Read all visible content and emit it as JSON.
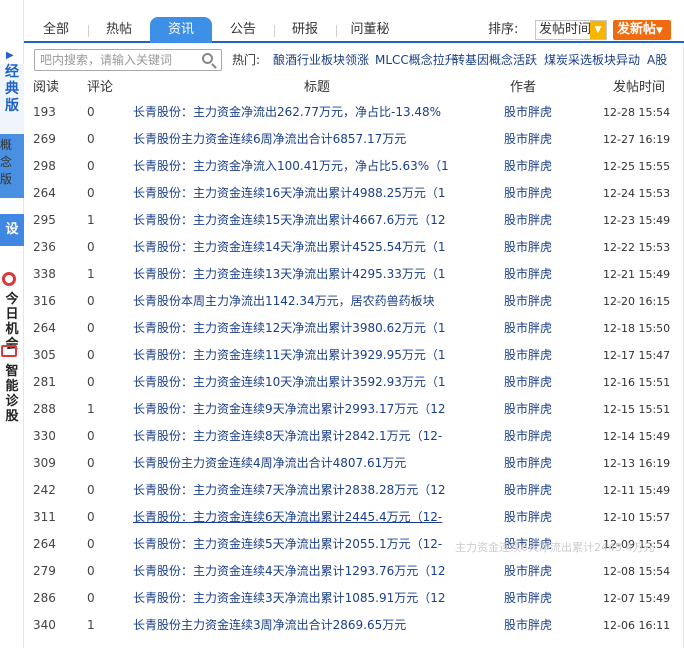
{
  "left_sidebar": {
    "classic_label": [
      "经",
      "典",
      "版"
    ],
    "concept_label": [
      "概",
      "念",
      "版"
    ],
    "settings_label": "设置",
    "meeting_label": [
      "今日",
      "机会"
    ],
    "diagnosis_label": [
      "智能",
      "诊股"
    ]
  },
  "tabs": [
    {
      "label": "全部",
      "active": false
    },
    {
      "label": "热帖",
      "active": false
    },
    {
      "label": "资讯",
      "active": true
    },
    {
      "label": "公告",
      "active": false
    },
    {
      "label": "研报",
      "active": false
    },
    {
      "label": "问董秘",
      "active": false
    }
  ],
  "sort": {
    "label": "排序:",
    "selected": "发帖时间"
  },
  "new_post_button": "发新帖",
  "search": {
    "placeholder": "吧内搜索，请输入关键词"
  },
  "hot": {
    "label": "热门:",
    "links": [
      "酿酒行业板块领涨",
      "MLCC概念拉升",
      "转基因概念活跃",
      "煤炭采选板块异动",
      "A股"
    ]
  },
  "table_header": {
    "read": "阅读",
    "comment": "评论",
    "title": "标题",
    "author": "作者",
    "time": "发帖时间"
  },
  "rows": [
    {
      "read": "193",
      "comment": "0",
      "title": "长青股份：主力资金净流出262.77万元，净占比-13.48%",
      "author": "股市胖虎",
      "time": "12-28 15:54"
    },
    {
      "read": "269",
      "comment": "0",
      "title": "长青股份主力资金连续6周净流出合计6857.17万元",
      "author": "股市胖虎",
      "time": "12-27 16:19"
    },
    {
      "read": "298",
      "comment": "0",
      "title": "长青股份：主力资金净流入100.41万元，净占比5.63%（1",
      "author": "股市胖虎",
      "time": "12-25 15:55"
    },
    {
      "read": "264",
      "comment": "0",
      "title": "长青股份：主力资金连续16天净流出累计4988.25万元（1",
      "author": "股市胖虎",
      "time": "12-24 15:53"
    },
    {
      "read": "295",
      "comment": "1",
      "title": "长青股份：主力资金连续15天净流出累计4667.6万元（12",
      "author": "股市胖虎",
      "time": "12-23 15:49"
    },
    {
      "read": "236",
      "comment": "0",
      "title": "长青股份：主力资金连续14天净流出累计4525.54万元（1",
      "author": "股市胖虎",
      "time": "12-22 15:53"
    },
    {
      "read": "338",
      "comment": "1",
      "title": "长青股份：主力资金连续13天净流出累计4295.33万元（1",
      "author": "股市胖虎",
      "time": "12-21 15:49"
    },
    {
      "read": "316",
      "comment": "0",
      "title": "长青股份本周主力净流出1142.34万元，居农药兽药板块",
      "author": "股市胖虎",
      "time": "12-20 16:15"
    },
    {
      "read": "264",
      "comment": "0",
      "title": "长青股份：主力资金连续12天净流出累计3980.62万元（1",
      "author": "股市胖虎",
      "time": "12-18 15:50"
    },
    {
      "read": "305",
      "comment": "0",
      "title": "长青股份：主力资金连续11天净流出累计3929.95万元（1",
      "author": "股市胖虎",
      "time": "12-17 15:47"
    },
    {
      "read": "281",
      "comment": "0",
      "title": "长青股份：主力资金连续10天净流出累计3592.93万元（1",
      "author": "股市胖虎",
      "time": "12-16 15:51"
    },
    {
      "read": "288",
      "comment": "1",
      "title": "长青股份：主力资金连续9天净流出累计2993.17万元（12",
      "author": "股市胖虎",
      "time": "12-15 15:51"
    },
    {
      "read": "330",
      "comment": "0",
      "title": "长青股份：主力资金连续8天净流出累计2842.1万元（12-",
      "author": "股市胖虎",
      "time": "12-14 15:49"
    },
    {
      "read": "309",
      "comment": "0",
      "title": "长青股份主力资金连续4周净流出合计4807.61万元",
      "author": "股市胖虎",
      "time": "12-13 16:19"
    },
    {
      "read": "242",
      "comment": "0",
      "title": "长青股份：主力资金连续7天净流出累计2838.28万元（12",
      "author": "股市胖虎",
      "time": "12-11 15:49"
    },
    {
      "read": "311",
      "comment": "0",
      "title": "长青股份：主力资金连续6天净流出累计2445.4万元（12-",
      "author": "股市胖虎",
      "time": "12-10 15:57"
    },
    {
      "read": "264",
      "comment": "0",
      "title": "长青股份：主力资金连续5天净流出累计2055.1万元（12-",
      "author": "股市胖虎",
      "time": "12-09 15:54"
    },
    {
      "read": "279",
      "comment": "0",
      "title": "长青股份：主力资金连续4天净流出累计1293.76万元（12",
      "author": "股市胖虎",
      "time": "12-08 15:54"
    },
    {
      "read": "286",
      "comment": "0",
      "title": "长青股份：主力资金连续3天净流出累计1085.91万元（12",
      "author": "股市胖虎",
      "time": "12-07 15:49"
    },
    {
      "read": "340",
      "comment": "1",
      "title": "长青股份主力资金连续3周净流出合计2869.65万元",
      "author": "股市胖虎",
      "time": "12-06 16:11"
    }
  ],
  "hover_tooltip": "主力资金连续6天净流出累计2445.4万元"
}
